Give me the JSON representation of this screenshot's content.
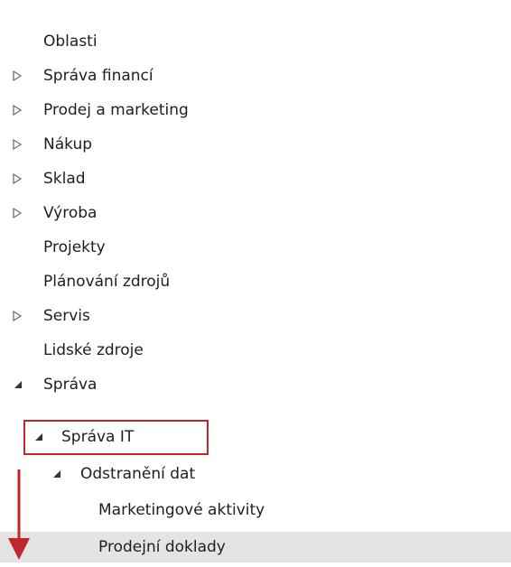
{
  "tree": {
    "items": [
      {
        "label": "Oblasti",
        "toggle": "none"
      },
      {
        "label": "Správa financí",
        "toggle": "collapsed"
      },
      {
        "label": "Prodej a marketing",
        "toggle": "collapsed"
      },
      {
        "label": "Nákup",
        "toggle": "collapsed"
      },
      {
        "label": "Sklad",
        "toggle": "collapsed"
      },
      {
        "label": "Výroba",
        "toggle": "collapsed"
      },
      {
        "label": "Projekty",
        "toggle": "none"
      },
      {
        "label": "Plánování zdrojů",
        "toggle": "none"
      },
      {
        "label": "Servis",
        "toggle": "collapsed"
      },
      {
        "label": "Lidské zdroje",
        "toggle": "none"
      },
      {
        "label": "Správa",
        "toggle": "expanded"
      },
      {
        "label": "Správa IT",
        "toggle": "expanded"
      },
      {
        "label": "Odstranění dat",
        "toggle": "expanded"
      },
      {
        "label": "Marketingové aktivity",
        "toggle": "none"
      },
      {
        "label": "Prodejní doklady",
        "toggle": "none",
        "selected": true
      }
    ]
  },
  "annotations": {
    "highlight_color": "#c0272d",
    "arrow_color": "#c0272d"
  },
  "colors": {
    "text": "#1e1e1e",
    "toggle": "#6f6f6f",
    "selected_row": "#e4e4e4"
  }
}
